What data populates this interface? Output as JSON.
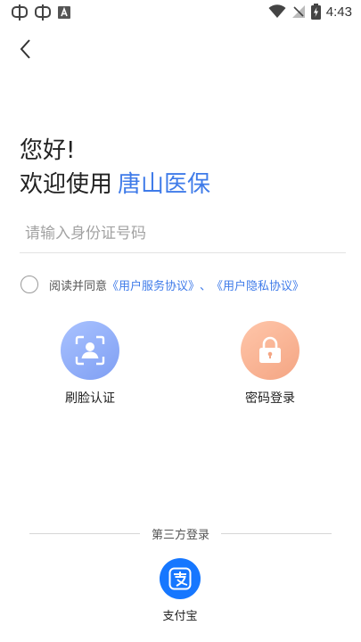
{
  "status_bar": {
    "time": "4:43",
    "left_icons": [
      "notification-app-icon",
      "notification-app-icon",
      "notification-a-icon"
    ],
    "right_icons": [
      "wifi-icon",
      "no-signal-icon",
      "battery-charging-icon"
    ]
  },
  "header": {
    "back_icon": "chevron-left-icon"
  },
  "greeting": {
    "line1": "您好!",
    "line2_prefix": "欢迎使用",
    "brand": "唐山医保",
    "brand_color": "#3f7be9"
  },
  "id_input": {
    "placeholder": "请输入身份证号码",
    "value": ""
  },
  "agreement": {
    "prefix": "阅读并同意",
    "service_link": "《用户服务协议》",
    "separator": "、",
    "privacy_link": "《用户隐私协议》",
    "checked": false
  },
  "login_options": [
    {
      "label": "刷脸认证",
      "icon": "face-scan-icon",
      "color": "#8aa8f6"
    },
    {
      "label": "密码登录",
      "icon": "lock-icon",
      "color": "#f6b292"
    }
  ],
  "third_party": {
    "title": "第三方登录",
    "alipay": {
      "label": "支付宝",
      "icon": "alipay-icon",
      "color": "#1677ff"
    }
  }
}
